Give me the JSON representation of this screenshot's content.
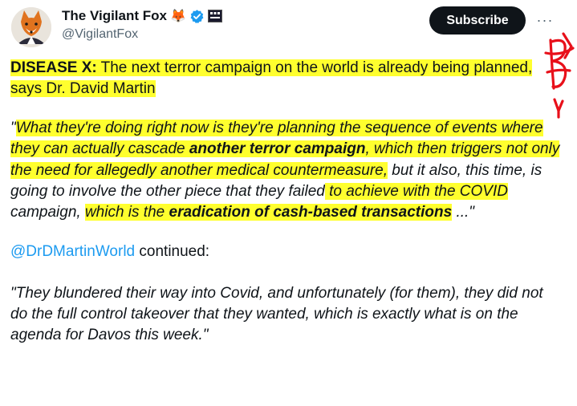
{
  "author": {
    "display_name": "The Vigilant Fox",
    "handle": "@VigilantFox",
    "emoji": "🦊"
  },
  "actions": {
    "subscribe_label": "Subscribe",
    "more_label": "···"
  },
  "tweet": {
    "p1_bold": "DISEASE X:",
    "p1_rest": " The next terror campaign on the world is already being planned, says Dr. David Martin",
    "q_open": "\"",
    "q_a": "What they're doing right now is they're planning the sequence of events where they can actually cascade ",
    "q_b": "another terror campaign",
    "q_c": ", which then triggers not only the need for allegedly another medical countermeasure,",
    "q_d": " but it also, this time, is going to involve the other piece that they failed",
    "q_e": " to achieve with the COVID",
    "q_f": " campaign, ",
    "q_g": "which is the ",
    "q_h": "eradication of cash-based transactions",
    "q_i": " ...\"",
    "mention": "@DrDMartinWorld",
    "mention_rest": " continued:",
    "quote2": "\"They blundered their way into Covid, and unfortunately (for them), they did not do the full control takeover that they wanted, which is exactly what is on the agenda for Davos this week.\""
  },
  "colors": {
    "highlight": "#ffff2e",
    "link": "#1d9bf0",
    "verified": "#1d9bf0",
    "scribble": "#e8101a",
    "subscribe_bg": "#0f1419"
  }
}
